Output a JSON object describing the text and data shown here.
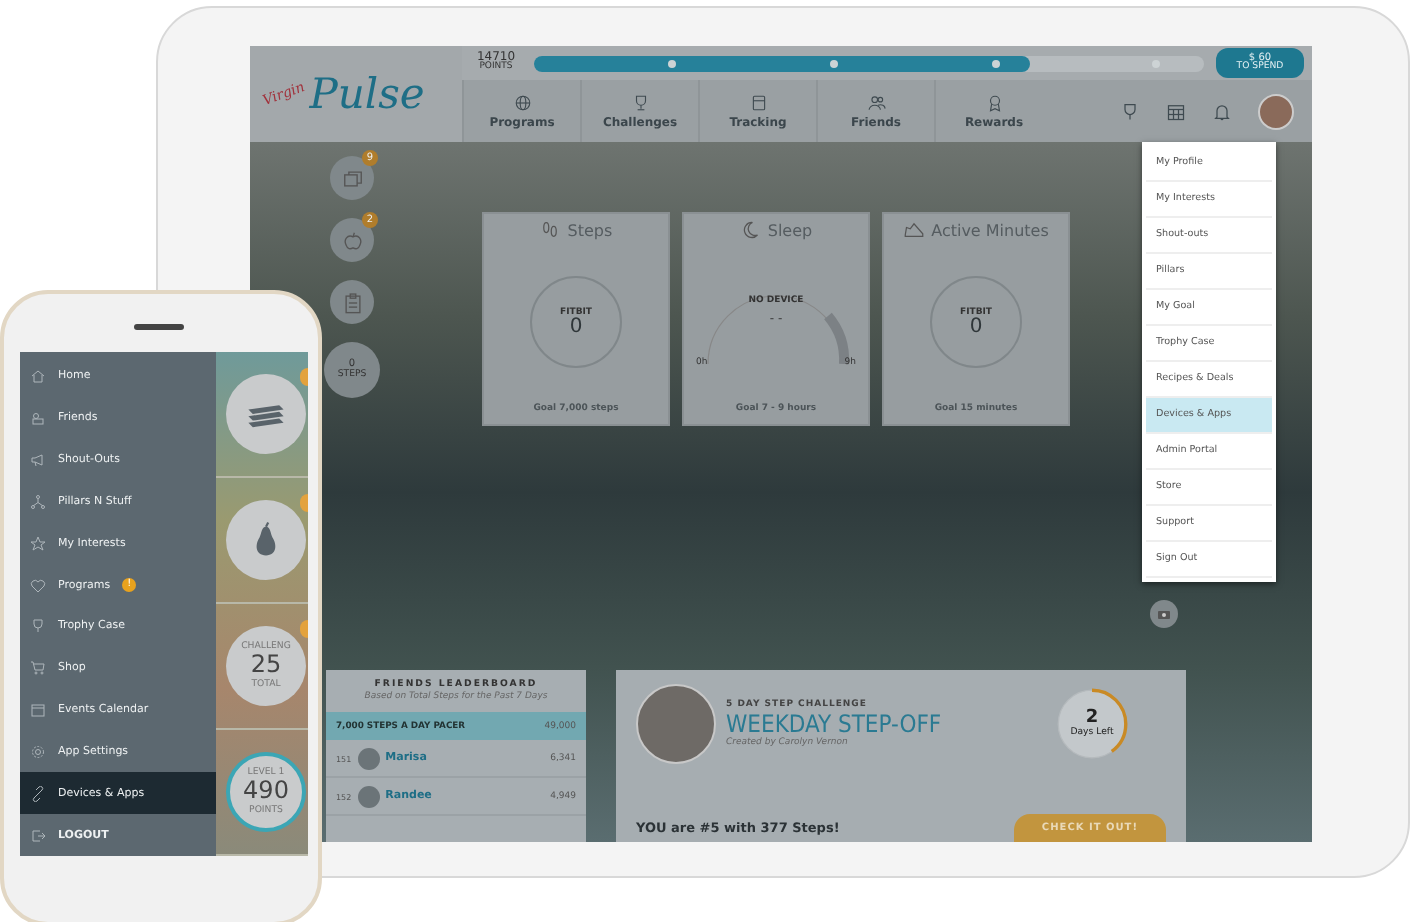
{
  "tablet": {
    "points": "14710",
    "points_label": "POINTS",
    "progress": {
      "level": 0.74
    },
    "cash": "$ 60",
    "cash_label": "TO SPEND",
    "logo": {
      "small": "Virgin",
      "big": "Pulse"
    },
    "nav": [
      {
        "label": "Programs",
        "kind": "globe"
      },
      {
        "label": "Challenges",
        "kind": "trophy"
      },
      {
        "label": "Tracking",
        "kind": "notebook"
      },
      {
        "label": "Friends",
        "kind": "people"
      },
      {
        "label": "Rewards",
        "kind": "medal"
      }
    ],
    "profile_menu": [
      {
        "label": "My Profile",
        "selected": false
      },
      {
        "label": "My Interests",
        "selected": false
      },
      {
        "label": "Shout-outs",
        "selected": false
      },
      {
        "label": "Pillars",
        "selected": false
      },
      {
        "label": "My Goal",
        "selected": false
      },
      {
        "label": "Trophy Case",
        "selected": false
      },
      {
        "label": "Recipes & Deals",
        "selected": false
      },
      {
        "label": "Devices & Apps",
        "selected": true
      },
      {
        "label": "Admin Portal",
        "selected": false
      },
      {
        "label": "Store",
        "selected": false
      },
      {
        "label": "Support",
        "selected": false
      },
      {
        "label": "Sign Out",
        "selected": false
      }
    ],
    "side_buttons": [
      {
        "kind": "cards",
        "badge": "9"
      },
      {
        "kind": "apple",
        "badge": "2"
      },
      {
        "kind": "clipboard"
      },
      {
        "kind": "steps",
        "value": "0",
        "label": "STEPS"
      }
    ],
    "cards": [
      {
        "kind": "ring",
        "title": "Steps",
        "source": "FITBIT",
        "value": "0",
        "goal": "Goal 7,000 steps"
      },
      {
        "kind": "gauge",
        "title": "Sleep",
        "source": "NO DEVICE",
        "value": "- -",
        "min": "0h",
        "max": "9h",
        "goal": "Goal 7 - 9 hours"
      },
      {
        "kind": "ring",
        "title": "Active Minutes",
        "source": "FITBIT",
        "value": "0",
        "goal": "Goal 15 minutes"
      }
    ],
    "leaderboard": {
      "title": "FRIENDS LEADERBOARD",
      "subtitle": "Based on Total Steps for the Past 7 Days",
      "team": {
        "name": "7,000 STEPS A DAY PACER",
        "score": "49,000"
      },
      "rows": [
        {
          "rank": "151",
          "name": "Marisa",
          "score": "6,341"
        },
        {
          "rank": "152",
          "name": "Randee",
          "score": "4,949"
        }
      ]
    },
    "challenge": {
      "kicker": "5 DAY STEP CHALLENGE",
      "title": "WEEKDAY STEP-OFF",
      "creator": "Created by Carolyn Vernon",
      "days": "2",
      "days_label": "Days Left",
      "level": 0.4,
      "status": "YOU are #5 with 377 Steps!",
      "button": "CHECK IT OUT!"
    }
  },
  "phone": {
    "menu": [
      {
        "label": "Home",
        "kind": "home",
        "selected": false
      },
      {
        "label": "Friends",
        "kind": "friends",
        "selected": false
      },
      {
        "label": "Shout-Outs",
        "kind": "megaphone",
        "selected": false
      },
      {
        "label": "Pillars N Stuff",
        "kind": "pillars",
        "selected": false
      },
      {
        "label": "My Interests",
        "kind": "star",
        "selected": false
      },
      {
        "label": "Programs",
        "kind": "heart",
        "badge": "!",
        "selected": false
      },
      {
        "label": "Trophy Case",
        "kind": "trophy",
        "selected": false
      },
      {
        "label": "Shop",
        "kind": "cart",
        "selected": false
      },
      {
        "label": "Events Calendar",
        "kind": "calendar",
        "selected": false
      },
      {
        "label": "App Settings",
        "kind": "gear",
        "selected": false
      },
      {
        "label": "Devices & Apps",
        "kind": "link",
        "selected": true
      },
      {
        "label": "LOGOUT",
        "kind": "logout",
        "selected": false
      }
    ],
    "tiles": [
      {
        "kind": "cards"
      },
      {
        "kind": "pear"
      },
      {
        "kind": "stat",
        "label": "CHALLENG",
        "value": "25",
        "sub": "TOTAL"
      },
      {
        "kind": "level",
        "label": "LEVEL 1",
        "value": "490",
        "sub": "POINTS"
      }
    ]
  }
}
